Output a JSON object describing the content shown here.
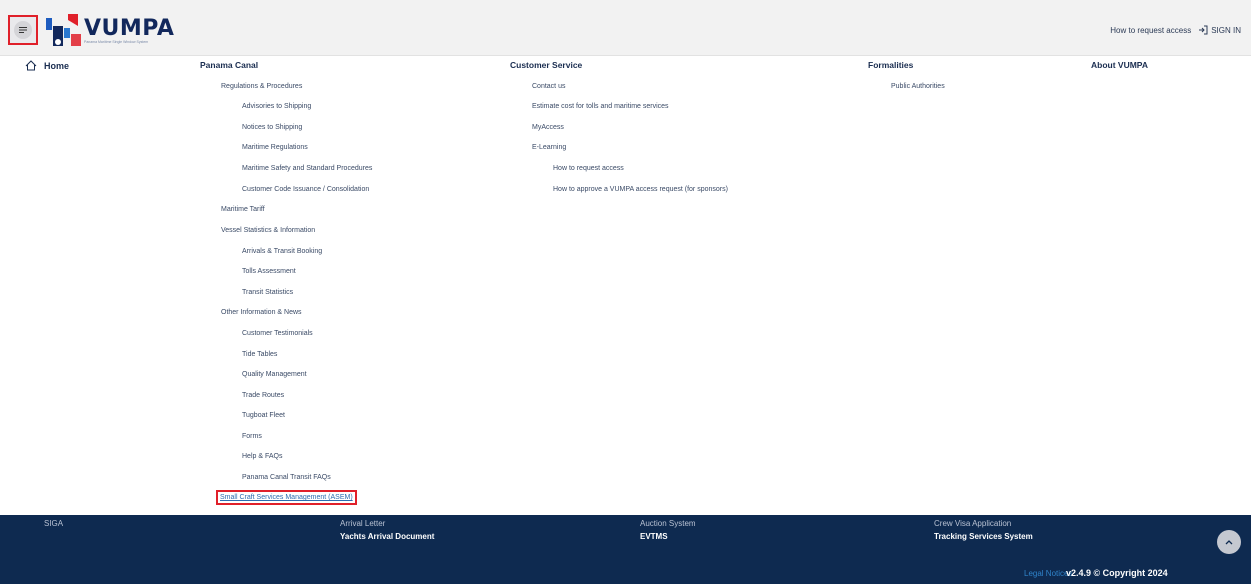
{
  "header": {
    "logo_text": "VUMPA",
    "logo_subtitle": "Panama Maritime Single Window System",
    "request_access": "How to request access",
    "sign_in": "SIGN IN",
    "accent": "#e0202a",
    "brand": "#12285c"
  },
  "nav": {
    "home": "Home",
    "panama_canal": {
      "title": "Panama Canal",
      "items": [
        "Regulations & Procedures",
        "Advisories to Shipping",
        "Notices to Shipping",
        "Maritime Regulations",
        "Maritime Safety and Standard Procedures",
        "Customer Code Issuance / Consolidation",
        "Maritime Tariff",
        "Vessel Statistics & Information",
        "Arrivals & Transit Booking",
        "Tolls Assessment",
        "Transit Statistics",
        "Other Information & News",
        "Customer Testimonials",
        "Tide Tables",
        "Quality Management",
        "Trade Routes",
        "Tugboat Fleet",
        "Forms",
        "Help & FAQs",
        "Panama Canal Transit FAQs",
        "Small Craft Services Management (ASEM)"
      ]
    },
    "customer_service": {
      "title": "Customer Service",
      "items": [
        "Contact us",
        "Estimate cost for tolls and maritime services",
        "MyAccess",
        "E-Learning",
        "How to request access",
        "How to approve a VUMPA access request (for sponsors)"
      ]
    },
    "formalities": {
      "title": "Formalities",
      "items": [
        "Public Authorities"
      ]
    },
    "about": {
      "title": "About VUMPA"
    }
  },
  "footer": {
    "links": [
      "SIGA",
      "Arrival Letter",
      "Yachts Arrival Document",
      "Auction System",
      "EVTMS",
      "Crew Visa Application",
      "Tracking Services System"
    ],
    "legal": "Legal Notices",
    "version": "v2.4.9 © Copyright 2024"
  },
  "icons": {
    "menu": "menu-icon",
    "home": "home-icon",
    "sign_in": "sign-in-icon",
    "scroll_top": "chevron-up-icon"
  }
}
